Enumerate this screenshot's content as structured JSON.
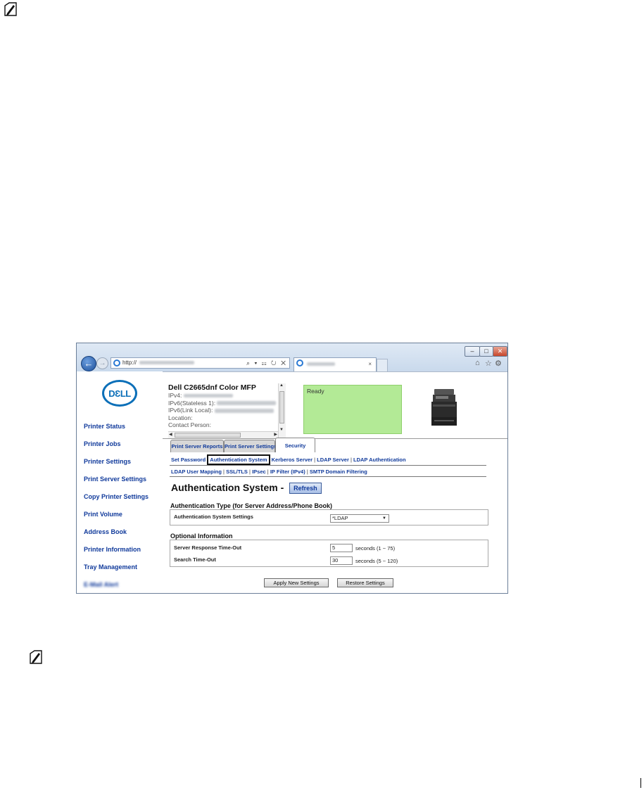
{
  "browser": {
    "address_prefix": "http://",
    "address_tools": "⌕ ▾ ☷ ↻ ✕",
    "tab_close": "×",
    "window_controls": {
      "minimize": "–",
      "maximize": "□",
      "close": "✕"
    },
    "toolbar_icons": [
      "home-icon",
      "star-icon",
      "gear-icon"
    ]
  },
  "logo": {
    "text": "DƐLL",
    "color": "#0b6fb8"
  },
  "sidebar": {
    "items": [
      {
        "label": "Printer Status"
      },
      {
        "label": "Printer Jobs"
      },
      {
        "label": "Printer Settings"
      },
      {
        "label": "Print Server Settings"
      },
      {
        "label": "Copy Printer Settings"
      },
      {
        "label": "Print Volume"
      },
      {
        "label": "Address Book"
      },
      {
        "label": "Printer Information"
      },
      {
        "label": "Tray Management"
      },
      {
        "label": "E-Mail Alert"
      }
    ]
  },
  "device": {
    "name": "Dell C2665dnf Color MFP",
    "ipv4_label": "IPv4:",
    "ipv6_stateless_label": "IPv6(Stateless 1):",
    "ipv6_linklocal_label": "IPv6(Link Local):",
    "location_label": "Location:",
    "contact_label": "Contact Person:",
    "status_text": "Ready",
    "status_color": "#b3ea96"
  },
  "tabs": [
    {
      "label": "Print Server Reports"
    },
    {
      "label": "Print Server Settings"
    },
    {
      "label": "Security"
    }
  ],
  "sublinks_row1": [
    "Set Password",
    "Authentication System",
    "Kerberos Server",
    "LDAP Server",
    "LDAP Authentication"
  ],
  "sublinks_row2": [
    "LDAP User Mapping",
    "SSL/TLS",
    "IPsec",
    "IP Filter (IPv4)",
    "SMTP Domain Filtering"
  ],
  "page": {
    "title": "Authentication System -",
    "refresh_label": "Refresh",
    "auth_type_heading": "Authentication Type (for Server Address/Phone Book)",
    "auth_settings_label": "Authentication System Settings",
    "auth_settings_value": "*LDAP",
    "optional_heading": "Optional Information",
    "server_timeout_label": "Server Response Time-Out",
    "server_timeout_value": "5",
    "server_timeout_unit": "seconds (1 ~ 75)",
    "search_timeout_label": "Search Time-Out",
    "search_timeout_value": "30",
    "search_timeout_unit": "seconds (5 ~ 120)",
    "apply_label": "Apply New Settings",
    "restore_label": "Restore Settings"
  },
  "separator": "|"
}
